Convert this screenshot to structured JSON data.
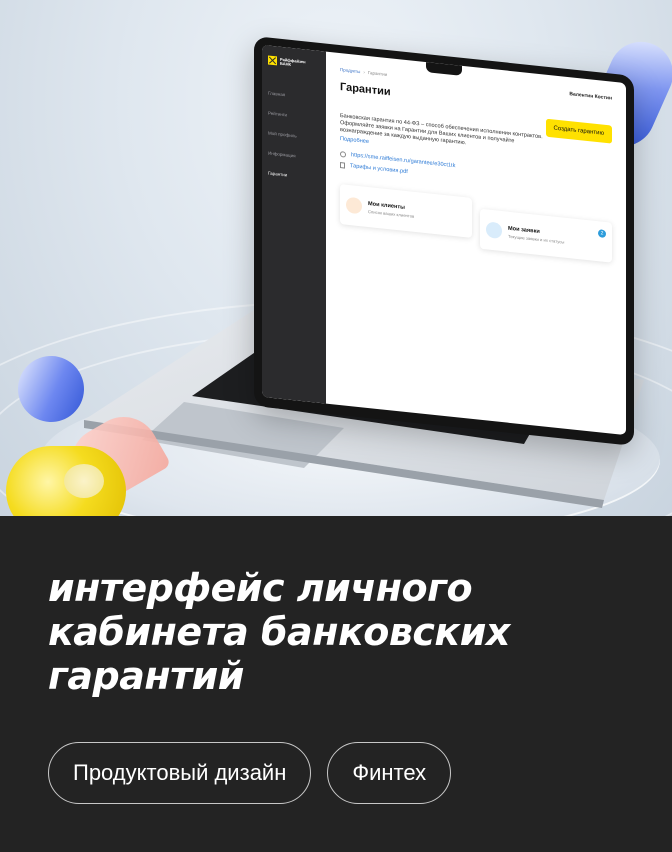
{
  "headline_lines": [
    "интерфейс личного",
    "кабинета банковских",
    "гарантий"
  ],
  "tags": [
    "Продуктовый дизайн",
    "Финтех"
  ],
  "app": {
    "logo_line1": "Райффайзен",
    "logo_line2": "БАНК",
    "nav": [
      "Главная",
      "Рейтинги",
      "Мой профиль",
      "Информация",
      "Гарантии"
    ],
    "nav_active_index": 4,
    "breadcrumb": {
      "parent": "Продукты",
      "separator": "›",
      "current": "Гарантии"
    },
    "user_name": "Валентин Костин",
    "page_title": "Гарантии",
    "create_button": "Создать гарантию",
    "description": "Банковская гарантия по 44-ФЗ – способ обеспечения исполнения контрактов. Оформляйте заявки на Гарантии для Ваших клиентов и получайте вознаграждение за каждую выданную гарантию.",
    "more_link": "Подробнее",
    "ref_link": "https://sme.raiffeisen.ru/garantee/e30ct1tk",
    "tariffs_link": "Тарифы и условия.pdf",
    "tiles": [
      {
        "title": "Мои клиенты",
        "subtitle": "Список ваших клиентов",
        "icon": "smile-icon"
      },
      {
        "title": "Мои заявки",
        "subtitle": "Текущие заявки и их статусы",
        "icon": "document-icon",
        "badge": "2"
      }
    ]
  },
  "colors": {
    "brand_yellow": "#ffe100",
    "link_blue": "#2e7bd6",
    "dark_bg": "#232323",
    "sidebar": "#2b2b2d"
  }
}
